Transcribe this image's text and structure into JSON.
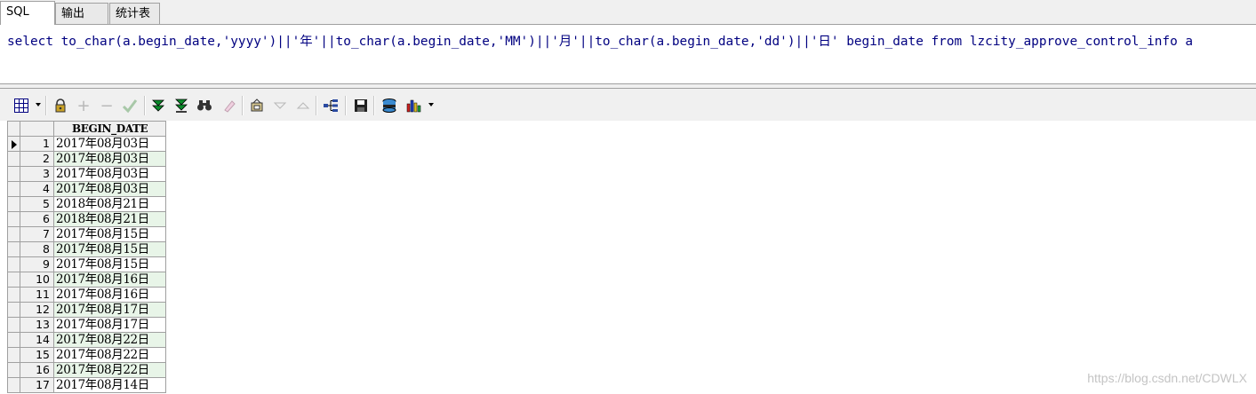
{
  "tabs": [
    {
      "label": "SQL",
      "active": true
    },
    {
      "label": "输出",
      "active": false
    },
    {
      "label": "统计表",
      "active": false
    }
  ],
  "editor": {
    "sql": "select to_char(a.begin_date,'yyyy')||'年'||to_char(a.begin_date,'MM')||'月'||to_char(a.begin_date,'dd')||'日' begin_date from lzcity_approve_control_info a"
  },
  "toolbar": {
    "icons": [
      "grid-menu-icon",
      "lock-icon",
      "add-row-icon",
      "delete-row-icon",
      "post-check-icon",
      "fetch-next-icon",
      "fetch-last-icon",
      "find-icon",
      "clear-icon",
      "export-icon",
      "filter-down-icon",
      "filter-up-icon",
      "tree-icon",
      "save-icon",
      "query-icon",
      "chart-icon"
    ]
  },
  "grid": {
    "column_header": "BEGIN_DATE",
    "rows": [
      {
        "num": "1",
        "value": "2017年08月03日"
      },
      {
        "num": "2",
        "value": "2017年08月03日"
      },
      {
        "num": "3",
        "value": "2017年08月03日"
      },
      {
        "num": "4",
        "value": "2017年08月03日"
      },
      {
        "num": "5",
        "value": "2018年08月21日"
      },
      {
        "num": "6",
        "value": "2018年08月21日"
      },
      {
        "num": "7",
        "value": "2017年08月15日"
      },
      {
        "num": "8",
        "value": "2017年08月15日"
      },
      {
        "num": "9",
        "value": "2017年08月15日"
      },
      {
        "num": "10",
        "value": "2017年08月16日"
      },
      {
        "num": "11",
        "value": "2017年08月16日"
      },
      {
        "num": "12",
        "value": "2017年08月17日"
      },
      {
        "num": "13",
        "value": "2017年08月17日"
      },
      {
        "num": "14",
        "value": "2017年08月22日"
      },
      {
        "num": "15",
        "value": "2017年08月22日"
      },
      {
        "num": "16",
        "value": "2017年08月22日"
      },
      {
        "num": "17",
        "value": "2017年08月14日"
      }
    ]
  },
  "watermark": "https://blog.csdn.net/CDWLX",
  "colors": {
    "alt_row": "#e8f5e8",
    "sql_text": "#000080",
    "chrome": "#f0f0f0"
  }
}
